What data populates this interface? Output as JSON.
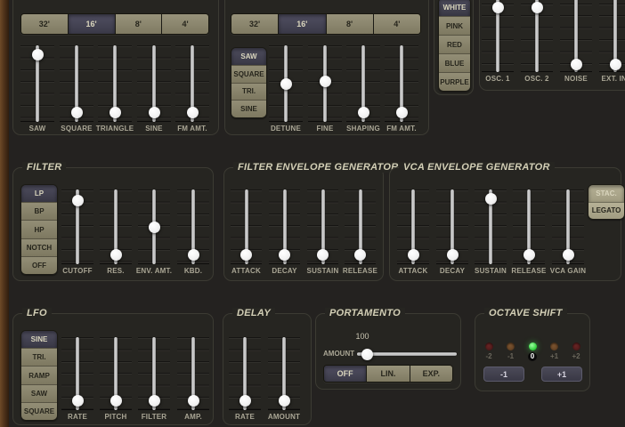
{
  "theme": {
    "khaki": "#8d8871",
    "selected_dark": "#46455a",
    "panel_bg": "#262521",
    "page_bg": "#242220",
    "wood_brown": "#50331a",
    "led_green": "#35d83f",
    "knob": "#ffffff",
    "label_text": "#aaa695",
    "title_text": "#d3cfb6"
  },
  "osc1": {
    "ranges": [
      "32'",
      "16'",
      "8'",
      "4'"
    ],
    "selected_range": "16'",
    "sliders": [
      {
        "label": "SAW",
        "value": 0.94
      },
      {
        "label": "SQUARE",
        "value": 0.06
      },
      {
        "label": "TRIANGLE",
        "value": 0.06
      },
      {
        "label": "SINE",
        "value": 0.06
      },
      {
        "label": "FM AMT.",
        "value": 0.06
      }
    ]
  },
  "osc2": {
    "ranges": [
      "32'",
      "16'",
      "8'",
      "4'"
    ],
    "selected_range": "16'",
    "waveforms": [
      "SAW",
      "SQUARE",
      "TRI.",
      "SINE"
    ],
    "selected_waveform": "SAW",
    "sliders": [
      {
        "label": "DETUNE",
        "value": 0.5
      },
      {
        "label": "FINE",
        "value": 0.53
      },
      {
        "label": "SHAPING",
        "value": 0.06
      },
      {
        "label": "FM AMT.",
        "value": 0.06
      }
    ]
  },
  "noise": {
    "colors": [
      "WHITE",
      "PINK",
      "RED",
      "BLUE",
      "PURPLE"
    ],
    "selected": "WHITE"
  },
  "mixer": {
    "sliders": [
      {
        "label": "OSC. 1",
        "value": 0.72
      },
      {
        "label": "OSC. 2",
        "value": 0.73
      },
      {
        "label": "NOISE",
        "value": 0.02
      },
      {
        "label": "EXT. IN.",
        "value": 0.02
      }
    ]
  },
  "filter": {
    "title": "FILTER",
    "modes": [
      "LP",
      "BP",
      "HP",
      "NOTCH",
      "OFF"
    ],
    "selected_mode": "LP",
    "sliders": [
      {
        "label": "CUTOFF",
        "value": 0.91
      },
      {
        "label": "RES.",
        "value": 0.06
      },
      {
        "label": "ENV. AMT.",
        "value": 0.5
      },
      {
        "label": "KBD.",
        "value": 0.06
      }
    ]
  },
  "filter_eg": {
    "title": "FILTER ENVELOPE GENERATOR",
    "sliders": [
      {
        "label": "ATTACK",
        "value": 0.06
      },
      {
        "label": "DECAY",
        "value": 0.06
      },
      {
        "label": "SUSTAIN",
        "value": 0.06
      },
      {
        "label": "RELEASE",
        "value": 0.06
      }
    ]
  },
  "vca_eg": {
    "title": "VCA ENVELOPE GENERATOR",
    "modes": [
      "STAC.",
      "LEGATO"
    ],
    "selected_mode": "STAC.",
    "sliders": [
      {
        "label": "ATTACK",
        "value": 0.06
      },
      {
        "label": "DECAY",
        "value": 0.06
      },
      {
        "label": "SUSTAIN",
        "value": 0.95
      },
      {
        "label": "RELEASE",
        "value": 0.06
      },
      {
        "label": "VCA GAIN",
        "value": 0.06
      }
    ]
  },
  "lfo": {
    "title": "LFO",
    "waveforms": [
      "SINE",
      "TRI.",
      "RAMP",
      "SAW",
      "SQUARE"
    ],
    "selected_waveform": "SINE",
    "sliders": [
      {
        "label": "RATE",
        "value": 0.06
      },
      {
        "label": "PITCH",
        "value": 0.06
      },
      {
        "label": "FILTER",
        "value": 0.06
      },
      {
        "label": "AMP.",
        "value": 0.06
      }
    ]
  },
  "delay": {
    "title": "DELAY",
    "sliders": [
      {
        "label": "RATE",
        "value": 0.06
      },
      {
        "label": "AMOUNT",
        "value": 0.06
      }
    ]
  },
  "portamento": {
    "title": "PORTAMENTO",
    "value": "100",
    "amount_label": "AMOUNT",
    "slider_value": 0.05,
    "modes": [
      "OFF",
      "LIN.",
      "EXP."
    ],
    "selected_mode": "OFF"
  },
  "octave_shift": {
    "title": "OCTAVE SHIFT",
    "leds": [
      {
        "label": "-2",
        "state": "red-dim",
        "active": false
      },
      {
        "label": "-1",
        "state": "amber-dim",
        "active": false
      },
      {
        "label": "0",
        "state": "green-on",
        "active": true
      },
      {
        "label": "+1",
        "state": "amber-dim",
        "active": false
      },
      {
        "label": "+2",
        "state": "red-dim",
        "active": false
      }
    ],
    "down_label": "-1",
    "up_label": "+1"
  }
}
